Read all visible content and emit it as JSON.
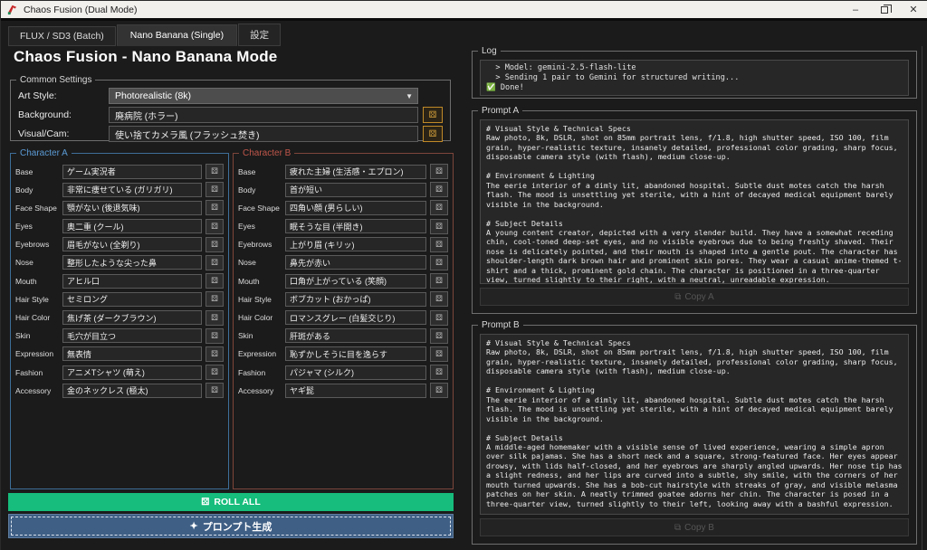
{
  "window": {
    "title": "Chaos Fusion (Dual Mode)",
    "minimize_glyph": "–",
    "close_glyph": "✕"
  },
  "tabs": [
    {
      "label": "FLUX / SD3 (Batch)"
    },
    {
      "label": "Nano Banana (Single)"
    },
    {
      "label": "設定"
    }
  ],
  "main": {
    "heading": "Chaos Fusion - Nano Banana Mode",
    "common_settings": {
      "title": "Common Settings",
      "art_style": {
        "label": "Art Style:",
        "value": "Photorealistic (8k)",
        "arrow_glyph": "▼"
      },
      "background": {
        "label": "Background:",
        "value": "廃病院 (ホラー)"
      },
      "visual_cam": {
        "label": "Visual/Cam:",
        "value": "使い捨てカメラ風 (フラッシュ焚き)"
      },
      "dice_glyph": "⚄"
    },
    "character_a": {
      "title": "Character A",
      "accent_color": "#5b9bd5",
      "fields": [
        {
          "label": "Base",
          "value": "ゲーム実況者"
        },
        {
          "label": "Body",
          "value": "非常に痩せている (ガリガリ)"
        },
        {
          "label": "Face Shape",
          "value": "顎がない (後退気味)"
        },
        {
          "label": "Eyes",
          "value": "奥二重 (クール)"
        },
        {
          "label": "Eyebrows",
          "value": "眉毛がない (全剃り)"
        },
        {
          "label": "Nose",
          "value": "整形したような尖った鼻"
        },
        {
          "label": "Mouth",
          "value": "アヒル口"
        },
        {
          "label": "Hair Style",
          "value": "セミロング"
        },
        {
          "label": "Hair Color",
          "value": "焦げ茶 (ダークブラウン)"
        },
        {
          "label": "Skin",
          "value": "毛穴が目立つ"
        },
        {
          "label": "Expression",
          "value": "無表情"
        },
        {
          "label": "Fashion",
          "value": "アニメTシャツ (萌え)"
        },
        {
          "label": "Accessory",
          "value": "金のネックレス (極太)"
        }
      ]
    },
    "character_b": {
      "title": "Character B",
      "accent_color": "#c0564a",
      "fields": [
        {
          "label": "Base",
          "value": "疲れた主婦 (生活感・エプロン)"
        },
        {
          "label": "Body",
          "value": "首が短い"
        },
        {
          "label": "Face Shape",
          "value": "四角い顔 (男らしい)"
        },
        {
          "label": "Eyes",
          "value": "眠そうな目 (半開き)"
        },
        {
          "label": "Eyebrows",
          "value": "上がり眉 (キリッ)"
        },
        {
          "label": "Nose",
          "value": "鼻先が赤い"
        },
        {
          "label": "Mouth",
          "value": "口角が上がっている (笑顔)"
        },
        {
          "label": "Hair Style",
          "value": "ボブカット (おかっぱ)"
        },
        {
          "label": "Hair Color",
          "value": "ロマンスグレー (白髪交じり)"
        },
        {
          "label": "Skin",
          "value": "肝斑がある"
        },
        {
          "label": "Expression",
          "value": "恥ずかしそうに目を逸らす"
        },
        {
          "label": "Fashion",
          "value": "パジャマ (シルク)"
        },
        {
          "label": "Accessory",
          "value": "ヤギ髭"
        }
      ]
    },
    "roll_all": {
      "label": "ROLL ALL",
      "icon_glyph": "⚄",
      "color": "#16bd7c"
    },
    "generate": {
      "label": "プロンプト生成",
      "icon_glyph": "✦",
      "color": "#3f5f85"
    }
  },
  "right": {
    "log": {
      "title": "Log",
      "lines": [
        "  > Model: gemini-2.5-flash-lite",
        "  > Sending 1 pair to Gemini for structured writing...",
        "✅ Done!"
      ]
    },
    "prompt_a": {
      "title": "Prompt A",
      "text": "# Visual Style & Technical Specs\nRaw photo, 8k, DSLR, shot on 85mm portrait lens, f/1.8, high shutter speed, ISO 100, film grain, hyper-realistic texture, insanely detailed, professional color grading, sharp focus, disposable camera style (with flash), medium close-up.\n\n# Environment & Lighting\nThe eerie interior of a dimly lit, abandoned hospital. Subtle dust motes catch the harsh flash. The mood is unsettling yet sterile, with a hint of decayed medical equipment barely visible in the background.\n\n# Subject Details\nA young content creator, depicted with a very slender build. They have a somewhat receding chin, cool-toned deep-set eyes, and no visible eyebrows due to being freshly shaved. Their nose is delicately pointed, and their mouth is shaped into a gentle pout. The character has shoulder-length dark brown hair and prominent skin pores. They wear a casual anime-themed t-shirt and a thick, prominent gold chain. The character is positioned in a three-quarter view, turned slightly to their right, with a neutral, unreadable expression.",
      "copy_label": "Copy A",
      "copy_icon_glyph": "⧉"
    },
    "prompt_b": {
      "title": "Prompt B",
      "text": "# Visual Style & Technical Specs\nRaw photo, 8k, DSLR, shot on 85mm portrait lens, f/1.8, high shutter speed, ISO 100, film grain, hyper-realistic texture, insanely detailed, professional color grading, sharp focus, disposable camera style (with flash), medium close-up.\n\n# Environment & Lighting\nThe eerie interior of a dimly lit, abandoned hospital. Subtle dust motes catch the harsh flash. The mood is unsettling yet sterile, with a hint of decayed medical equipment barely visible in the background.\n\n# Subject Details\nA middle-aged homemaker with a visible sense of lived experience, wearing a simple apron over silk pajamas. She has a short neck and a square, strong-featured face. Her eyes appear drowsy, with lids half-closed, and her eyebrows are sharply angled upwards. Her nose tip has a slight redness, and her lips are curved into a subtle, shy smile, with the corners of her mouth turned upwards. She has a bob-cut hairstyle with streaks of gray, and visible melasma patches on her skin. A neatly trimmed goatee adorns her chin. The character is posed in a three-quarter view, turned slightly to their left, looking away with a bashful expression.",
      "copy_label": "Copy B",
      "copy_icon_glyph": "⧉"
    }
  }
}
